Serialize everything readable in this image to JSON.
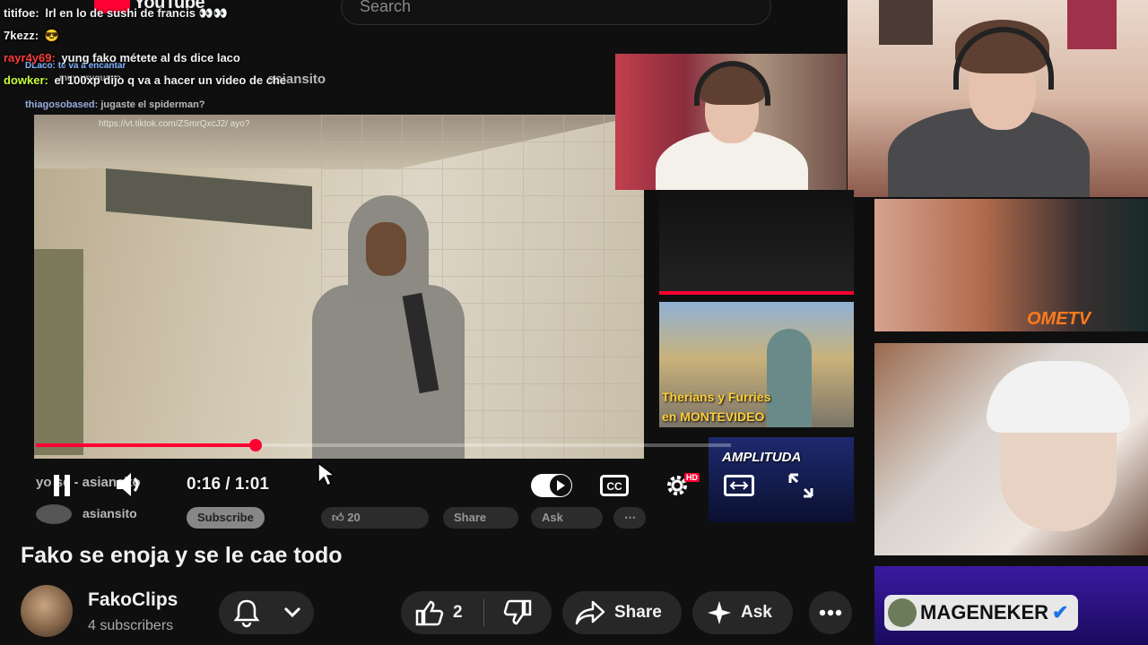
{
  "header": {
    "logo_text": "YouTube",
    "search_placeholder": "Search"
  },
  "chat": [
    {
      "user": "titifoe:",
      "message": "lrl en lo de sushi de francis",
      "user_color": "#ffffff",
      "emotes": "👀👀"
    },
    {
      "user": "7kezz:",
      "message": "",
      "user_color": "#ffffff",
      "emotes": "😎"
    },
    {
      "user": "rayr4y69:",
      "message": "yung fako métete al ds dice laco",
      "user_color": "#ff3c3c",
      "emotes": ""
    },
    {
      "user": "dowker:",
      "message": "el 100xp dijo q va a hacer un video de che",
      "user_color": "#c8ff3c",
      "emotes": ""
    }
  ],
  "embedded_chat": [
    {
      "user": "DLaco:",
      "message": "te va a encantar"
    },
    {
      "user": "",
      "message": "muy uruguayo"
    },
    {
      "user": "thiagosobased:",
      "message": "jugaste el spiderman?"
    },
    {
      "user": "",
      "message": "https://vt.tiktok.com/ZSmrQxcJ2/ ayo?"
    }
  ],
  "ghost": {
    "channel_handle": "asiansito",
    "song_title": "yo sé - asiansito",
    "under_channel": "asiansito",
    "subscribe": "Subscribe",
    "likes": "20",
    "share": "Share",
    "ask": "Ask"
  },
  "player": {
    "current_time": "0:16",
    "separator": " / ",
    "duration": "1:01",
    "progress_fraction": 0.316,
    "hd_badge": "HD"
  },
  "video": {
    "title": "Fako se enoja y se le cae todo",
    "channel_name": "FakoClips",
    "subscribers": "4 subscribers",
    "like_count": "2",
    "share_label": "Share",
    "ask_label": "Ask"
  },
  "thumbnails": {
    "therians_line1": "Therians y Furries",
    "therians_line2": "en MONTEVIDEO",
    "amplitude": "AMPLITUDA",
    "omegle": "OMETV",
    "mage": "MAGENEKER"
  },
  "colors": {
    "accent": "#ff0033",
    "background": "#0f0f0f",
    "pill": "#272727"
  }
}
